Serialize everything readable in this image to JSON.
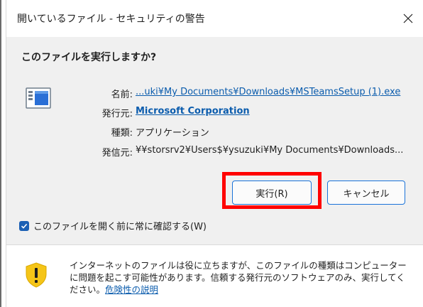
{
  "window": {
    "title": "開いているファイル - セキュリティの警告"
  },
  "dialog": {
    "question": "このファイルを実行しますか?",
    "rows": [
      {
        "label": "名前:",
        "value": "...uki¥My Documents¥Downloads¥MSTeamsSetup (1).exe"
      },
      {
        "label": "発行元:",
        "value": "Microsoft Corporation"
      },
      {
        "label": "種類:",
        "value": "アプリケーション"
      },
      {
        "label": "発信元:",
        "value": "¥¥storsrv2¥Users$¥ysuzuki¥My Documents¥Downloads..."
      }
    ],
    "run_label": "実行(R)",
    "cancel_label": "キャンセル",
    "checkbox_label": "このファイルを開く前に常に確認する(W)",
    "checkbox_checked": true
  },
  "footer": {
    "warning_text": "インターネットのファイルは役に立ちますが、このファイルの種類はコンピューターに問題を起こす可能性があります。信頼する発行元のソフトウェアのみ、実行してください。",
    "risk_link": "危険性の説明"
  },
  "colors": {
    "link": "#0b5cad",
    "highlight": "#ff0000",
    "accent": "#1a73d9",
    "shield": "#f5c518"
  },
  "icons": {
    "close": "close-icon",
    "app": "application-icon",
    "checkbox": "checkmark-icon",
    "warning": "warning-shield-icon"
  }
}
